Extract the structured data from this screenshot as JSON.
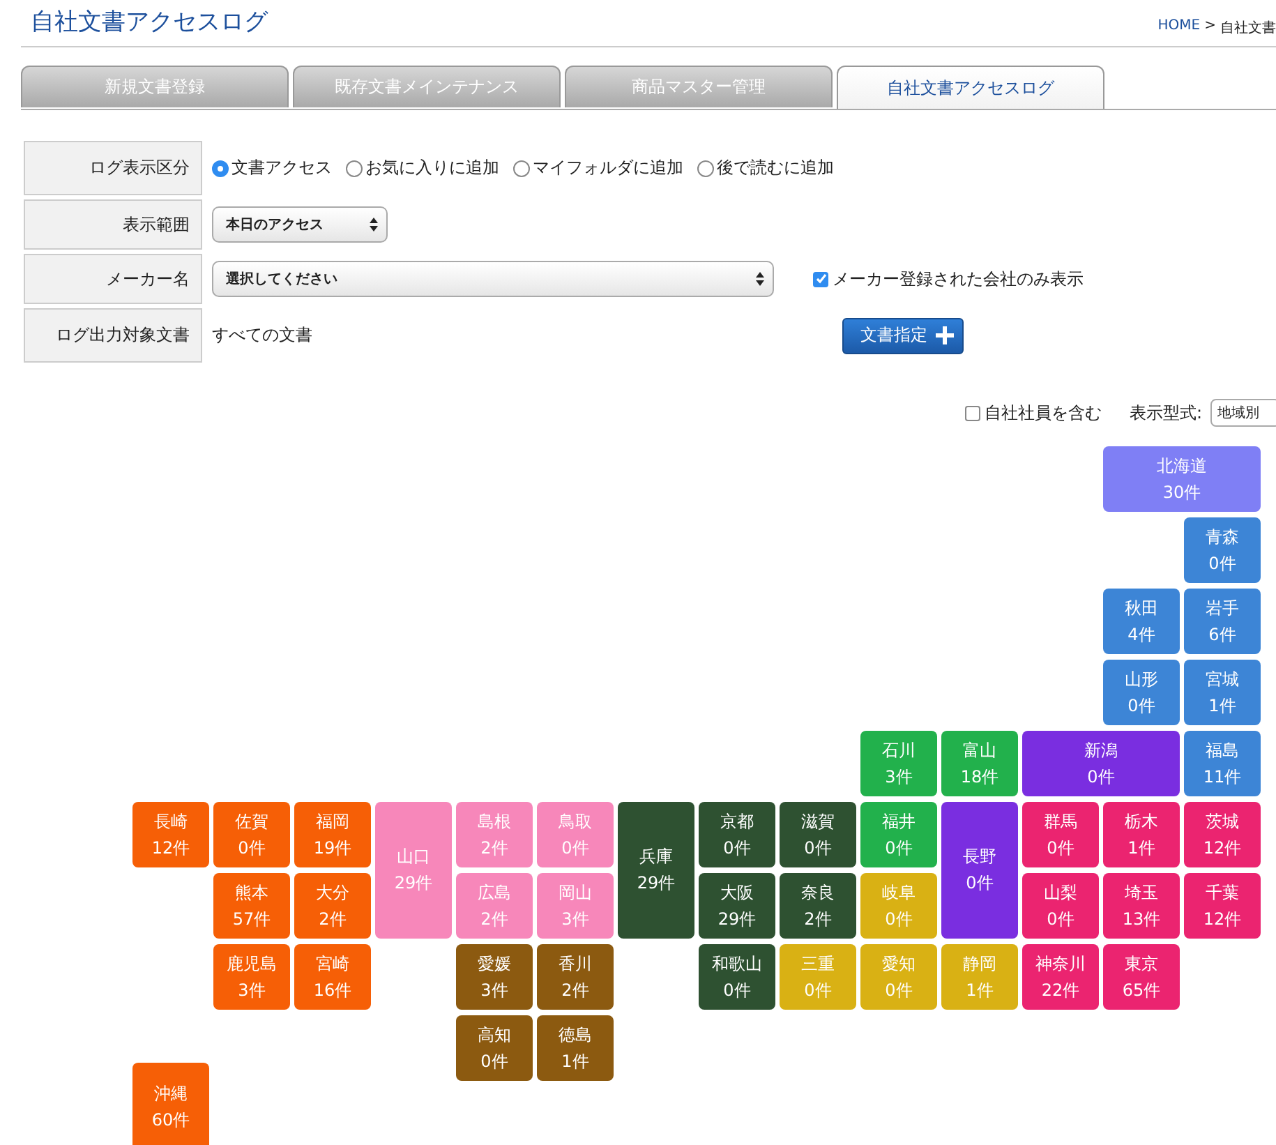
{
  "page_title": "自社文書アクセスログ",
  "breadcrumb": {
    "home": "HOME",
    "separator": ">",
    "current": "自社文書"
  },
  "tabs": [
    {
      "label": "新規文書登録",
      "selected": false
    },
    {
      "label": "既存文書メインテナンス",
      "selected": false
    },
    {
      "label": "商品マスター管理",
      "selected": false
    },
    {
      "label": "自社文書アクセスログ",
      "selected": true
    }
  ],
  "form": {
    "log_type": {
      "label": "ログ表示区分",
      "options": [
        {
          "label": "文書アクセス",
          "selected": true
        },
        {
          "label": "お気に入りに追加",
          "selected": false
        },
        {
          "label": "マイフォルダに追加",
          "selected": false
        },
        {
          "label": "後で読むに追加",
          "selected": false
        }
      ]
    },
    "range": {
      "label": "表示範囲",
      "value": "本日のアクセス"
    },
    "maker": {
      "label": "メーカー名",
      "value": "選択してください",
      "registered_only": {
        "label": "メーカー登録された会社のみ表示",
        "checked": true
      }
    },
    "target": {
      "label": "ログ出力対象文書",
      "value": "すべての文書",
      "button": "文書指定"
    }
  },
  "options": {
    "include_staff": {
      "label": "自社社員を含む",
      "checked": false
    },
    "display_label": "表示型式:",
    "display_value": "地域別"
  },
  "prefectures": [
    {
      "name": "北海道",
      "count": "30件",
      "color": "#7f7ff5"
    },
    {
      "name": "青森",
      "count": "0件",
      "color": "#3d85d6"
    },
    {
      "name": "秋田",
      "count": "4件",
      "color": "#3d85d6"
    },
    {
      "name": "岩手",
      "count": "6件",
      "color": "#3d85d6"
    },
    {
      "name": "山形",
      "count": "0件",
      "color": "#3d85d6"
    },
    {
      "name": "宮城",
      "count": "1件",
      "color": "#3d85d6"
    },
    {
      "name": "石川",
      "count": "3件",
      "color": "#22b14c"
    },
    {
      "name": "富山",
      "count": "18件",
      "color": "#22b14c"
    },
    {
      "name": "新潟",
      "count": "0件",
      "color": "#7a2ee0"
    },
    {
      "name": "福島",
      "count": "11件",
      "color": "#3d85d6"
    },
    {
      "name": "長崎",
      "count": "12件",
      "color": "#f65f06"
    },
    {
      "name": "佐賀",
      "count": "0件",
      "color": "#f65f06"
    },
    {
      "name": "福岡",
      "count": "19件",
      "color": "#f65f06"
    },
    {
      "name": "山口",
      "count": "29件",
      "color": "#f787ba"
    },
    {
      "name": "島根",
      "count": "2件",
      "color": "#f787ba"
    },
    {
      "name": "鳥取",
      "count": "0件",
      "color": "#f787ba"
    },
    {
      "name": "兵庫",
      "count": "29件",
      "color": "#2e5131"
    },
    {
      "name": "京都",
      "count": "0件",
      "color": "#2e5131"
    },
    {
      "name": "滋賀",
      "count": "0件",
      "color": "#2e5131"
    },
    {
      "name": "福井",
      "count": "0件",
      "color": "#22b14c"
    },
    {
      "name": "長野",
      "count": "0件",
      "color": "#7a2ee0"
    },
    {
      "name": "群馬",
      "count": "0件",
      "color": "#eb2470"
    },
    {
      "name": "栃木",
      "count": "1件",
      "color": "#eb2470"
    },
    {
      "name": "茨城",
      "count": "12件",
      "color": "#eb2470"
    },
    {
      "name": "熊本",
      "count": "57件",
      "color": "#f65f06"
    },
    {
      "name": "大分",
      "count": "2件",
      "color": "#f65f06"
    },
    {
      "name": "広島",
      "count": "2件",
      "color": "#f787ba"
    },
    {
      "name": "岡山",
      "count": "3件",
      "color": "#f787ba"
    },
    {
      "name": "大阪",
      "count": "29件",
      "color": "#2e5131"
    },
    {
      "name": "奈良",
      "count": "2件",
      "color": "#2e5131"
    },
    {
      "name": "岐阜",
      "count": "0件",
      "color": "#d9b114"
    },
    {
      "name": "山梨",
      "count": "0件",
      "color": "#eb2470"
    },
    {
      "name": "埼玉",
      "count": "13件",
      "color": "#eb2470"
    },
    {
      "name": "千葉",
      "count": "12件",
      "color": "#eb2470"
    },
    {
      "name": "鹿児島",
      "count": "3件",
      "color": "#f65f06"
    },
    {
      "name": "宮崎",
      "count": "16件",
      "color": "#f65f06"
    },
    {
      "name": "愛媛",
      "count": "3件",
      "color": "#8c5a10"
    },
    {
      "name": "香川",
      "count": "2件",
      "color": "#8c5a10"
    },
    {
      "name": "和歌山",
      "count": "0件",
      "color": "#2e5131"
    },
    {
      "name": "三重",
      "count": "0件",
      "color": "#d9b114"
    },
    {
      "name": "愛知",
      "count": "0件",
      "color": "#d9b114"
    },
    {
      "name": "静岡",
      "count": "1件",
      "color": "#d9b114"
    },
    {
      "name": "神奈川",
      "count": "22件",
      "color": "#eb2470"
    },
    {
      "name": "東京",
      "count": "65件",
      "color": "#eb2470"
    },
    {
      "name": "高知",
      "count": "0件",
      "color": "#8c5a10"
    },
    {
      "name": "徳島",
      "count": "1件",
      "color": "#8c5a10"
    },
    {
      "name": "沖縄",
      "count": "60件",
      "color": "#f65f06"
    }
  ]
}
